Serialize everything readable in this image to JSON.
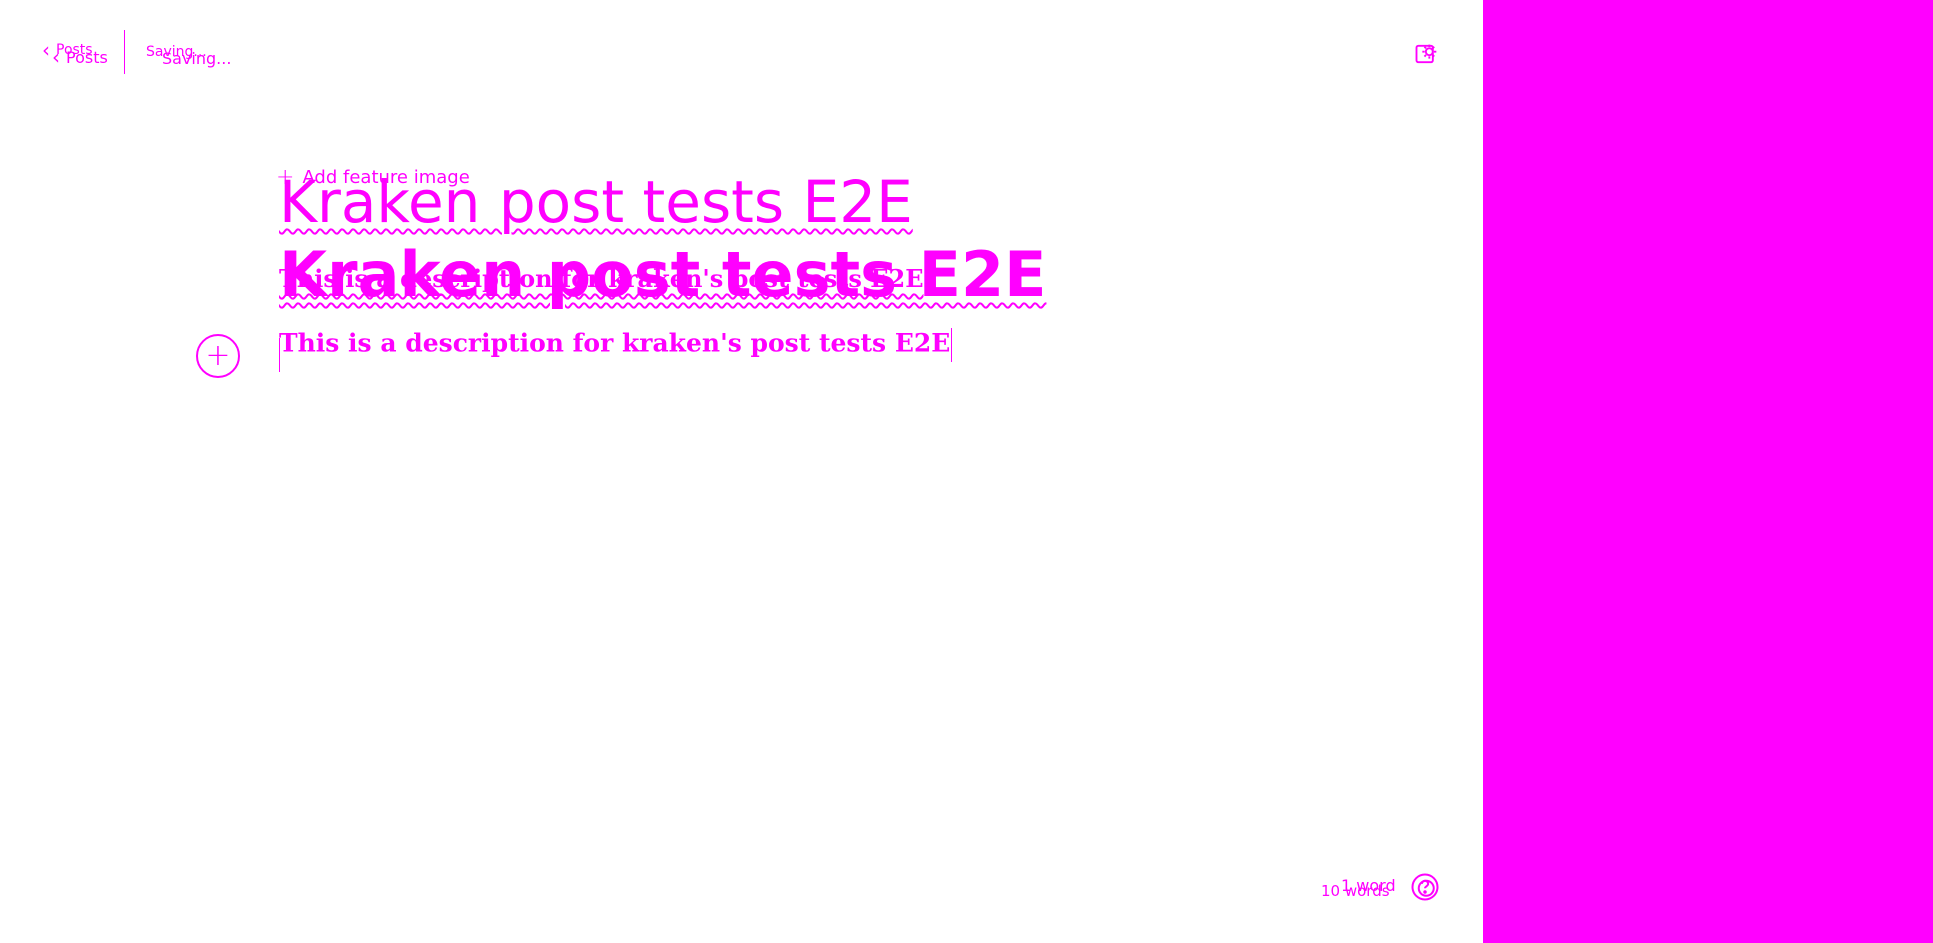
{
  "header": {
    "back_label_a": "Posts",
    "back_label_b": "Posts",
    "status_a": "Saving...",
    "status_b": "Saving..."
  },
  "editor": {
    "feature_image_label": "Add feature image",
    "title_a": "Kraken post tests E2E",
    "title_b": "Kraken post tests E2E",
    "description_ghost": "This is a description for kraken's post tests E2E",
    "description": "This is a description for kraken's post tests E2E"
  },
  "footer": {
    "word_count_a": "1 word",
    "word_count_b": "10 words"
  },
  "icons": {
    "back": "chevron-left-icon",
    "settings": "settings-icon",
    "add_card": "plus-circle-icon",
    "help": "help-icon"
  },
  "colors": {
    "accent": "#ff00ff",
    "background": "#ffffff"
  }
}
